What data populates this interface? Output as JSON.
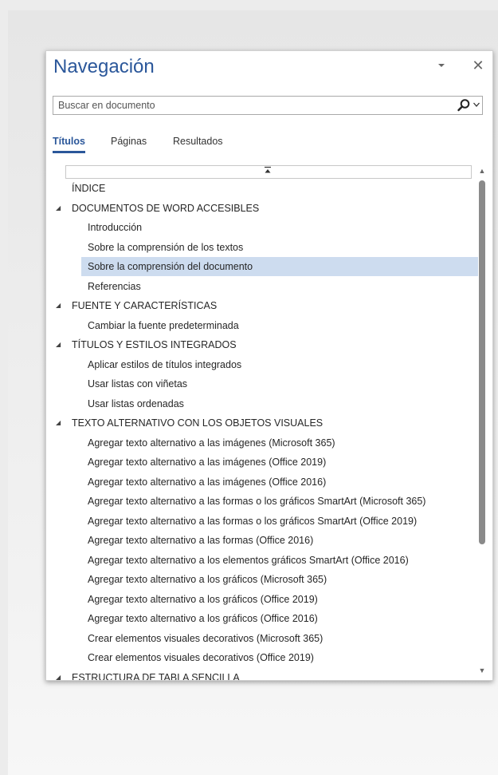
{
  "pane": {
    "title": "Navegación",
    "menu_icon": "chevron-down-icon",
    "close_icon": "close-icon",
    "close_glyph": "✕"
  },
  "search": {
    "placeholder": "Buscar en documento"
  },
  "tabs": [
    {
      "label": "Títulos",
      "active": true
    },
    {
      "label": "Páginas",
      "active": false
    },
    {
      "label": "Resultados",
      "active": false
    }
  ],
  "tree": [
    {
      "label": "ÍNDICE",
      "level": 1,
      "expanded": null,
      "selected": false
    },
    {
      "label": "DOCUMENTOS DE WORD ACCESIBLES",
      "level": 1,
      "expanded": true,
      "selected": false
    },
    {
      "label": "Introducción",
      "level": 2,
      "expanded": null,
      "selected": false
    },
    {
      "label": "Sobre la comprensión de los textos",
      "level": 2,
      "expanded": null,
      "selected": false
    },
    {
      "label": "Sobre la comprensión del documento",
      "level": 2,
      "expanded": null,
      "selected": true
    },
    {
      "label": "Referencias",
      "level": 2,
      "expanded": null,
      "selected": false
    },
    {
      "label": "FUENTE Y CARACTERÍSTICAS",
      "level": 1,
      "expanded": true,
      "selected": false
    },
    {
      "label": "Cambiar la fuente predeterminada",
      "level": 2,
      "expanded": null,
      "selected": false
    },
    {
      "label": "TÍTULOS Y ESTILOS INTEGRADOS",
      "level": 1,
      "expanded": true,
      "selected": false
    },
    {
      "label": "Aplicar estilos de títulos integrados",
      "level": 2,
      "expanded": null,
      "selected": false
    },
    {
      "label": "Usar listas con viñetas",
      "level": 2,
      "expanded": null,
      "selected": false
    },
    {
      "label": "Usar listas ordenadas",
      "level": 2,
      "expanded": null,
      "selected": false
    },
    {
      "label": "TEXTO ALTERNATIVO CON LOS OBJETOS VISUALES",
      "level": 1,
      "expanded": true,
      "selected": false
    },
    {
      "label": "Agregar texto alternativo a las imágenes (Microsoft 365)",
      "level": 2,
      "expanded": null,
      "selected": false
    },
    {
      "label": "Agregar texto alternativo a las imágenes (Office 2019)",
      "level": 2,
      "expanded": null,
      "selected": false
    },
    {
      "label": "Agregar texto alternativo a las imágenes (Office 2016)",
      "level": 2,
      "expanded": null,
      "selected": false
    },
    {
      "label": "Agregar texto alternativo a las formas o los gráficos SmartArt (Microsoft 365)",
      "level": 2,
      "expanded": null,
      "selected": false
    },
    {
      "label": "Agregar texto alternativo a las formas o los gráficos SmartArt (Office 2019)",
      "level": 2,
      "expanded": null,
      "selected": false
    },
    {
      "label": "Agregar texto alternativo a las formas (Office 2016)",
      "level": 2,
      "expanded": null,
      "selected": false
    },
    {
      "label": "Agregar texto alternativo a los elementos gráficos SmartArt (Office 2016)",
      "level": 2,
      "expanded": null,
      "selected": false
    },
    {
      "label": "Agregar texto alternativo a los gráficos (Microsoft 365)",
      "level": 2,
      "expanded": null,
      "selected": false
    },
    {
      "label": "Agregar texto alternativo a los gráficos (Office 2019)",
      "level": 2,
      "expanded": null,
      "selected": false
    },
    {
      "label": "Agregar texto alternativo a los gráficos (Office 2016)",
      "level": 2,
      "expanded": null,
      "selected": false
    },
    {
      "label": "Crear elementos visuales decorativos (Microsoft 365)",
      "level": 2,
      "expanded": null,
      "selected": false
    },
    {
      "label": "Crear elementos visuales decorativos (Office 2019)",
      "level": 2,
      "expanded": null,
      "selected": false
    },
    {
      "label": "ESTRUCTURA DE TABLA SENCILLA",
      "level": 1,
      "expanded": true,
      "selected": false
    }
  ],
  "colors": {
    "accent": "#2b579a",
    "selection": "#cddcef"
  }
}
